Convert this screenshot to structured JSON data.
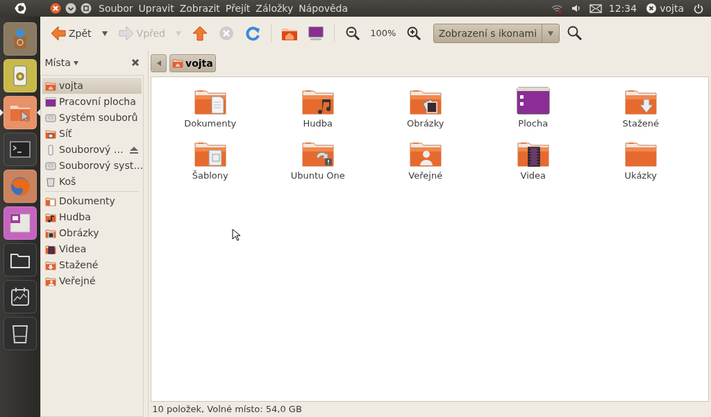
{
  "top_panel": {
    "menu": [
      "Soubor",
      "Upravit",
      "Zobrazit",
      "Přejít",
      "Záložky",
      "Nápověda"
    ],
    "clock": "12:34",
    "user": "vojta"
  },
  "launcher": [
    {
      "kind": "store",
      "color": "#8a7a62",
      "selected": false
    },
    {
      "kind": "speaker",
      "color": "#c9b94a",
      "selected": false
    },
    {
      "kind": "files",
      "color": "#e8926a",
      "selected": true
    },
    {
      "kind": "terminal",
      "color": "#3a3a3a",
      "selected": false
    },
    {
      "kind": "browser",
      "color": "#c9835e",
      "selected": false
    },
    {
      "kind": "workspaces",
      "color": "#c564c0",
      "selected": false
    },
    {
      "kind": "folder",
      "color": "#2f2f2f",
      "selected": false
    },
    {
      "kind": "monitor",
      "color": "#2f2f2f",
      "selected": false
    },
    {
      "kind": "trash",
      "color": "#2f2f2f",
      "selected": false
    }
  ],
  "toolbar": {
    "back": {
      "label": "Zpět",
      "disabled": false
    },
    "forward": {
      "label": "Vpřed",
      "disabled": true
    },
    "zoom": "100%",
    "view_mode": "Zobrazení s ikonami"
  },
  "sidebar": {
    "title": "Místa",
    "sections": [
      [
        {
          "label": "vojta",
          "kind": "home",
          "selected": true,
          "eject": false
        },
        {
          "label": "Pracovní plocha",
          "kind": "desktop",
          "selected": false,
          "eject": false
        },
        {
          "label": "Systém souborů",
          "kind": "drive",
          "selected": false,
          "eject": false
        },
        {
          "label": "Síť",
          "kind": "network",
          "selected": false,
          "eject": false
        },
        {
          "label": "Souborový …",
          "kind": "usb",
          "selected": false,
          "eject": true
        },
        {
          "label": "Souborový syst…",
          "kind": "drive",
          "selected": false,
          "eject": false
        },
        {
          "label": "Koš",
          "kind": "trash",
          "selected": false,
          "eject": false
        }
      ],
      [
        {
          "label": "Dokumenty",
          "kind": "documents",
          "selected": false,
          "eject": false
        },
        {
          "label": "Hudba",
          "kind": "music",
          "selected": false,
          "eject": false
        },
        {
          "label": "Obrázky",
          "kind": "pictures",
          "selected": false,
          "eject": false
        },
        {
          "label": "Videa",
          "kind": "videos",
          "selected": false,
          "eject": false
        },
        {
          "label": "Stažené",
          "kind": "download",
          "selected": false,
          "eject": false
        },
        {
          "label": "Veřejné",
          "kind": "public",
          "selected": false,
          "eject": false
        }
      ]
    ]
  },
  "path": [
    {
      "label": "vojta",
      "selected": true
    }
  ],
  "files": [
    {
      "name": "Dokumenty",
      "kind": "documents"
    },
    {
      "name": "Hudba",
      "kind": "music"
    },
    {
      "name": "Obrázky",
      "kind": "pictures"
    },
    {
      "name": "Plocha",
      "kind": "desktop"
    },
    {
      "name": "Stažené",
      "kind": "download"
    },
    {
      "name": "Šablony",
      "kind": "templates"
    },
    {
      "name": "Ubuntu One",
      "kind": "ubuntuone"
    },
    {
      "name": "Veřejné",
      "kind": "public"
    },
    {
      "name": "Videa",
      "kind": "videos"
    },
    {
      "name": "Ukázky",
      "kind": "examples"
    }
  ],
  "status_bar": "10 položek, Volné místo: 54,0 GB"
}
